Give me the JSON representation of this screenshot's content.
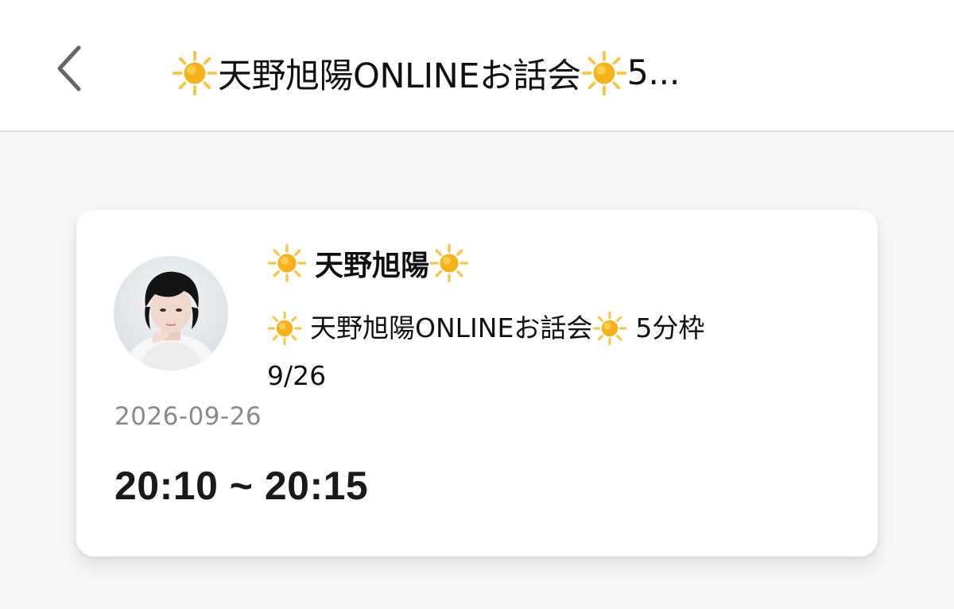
{
  "header": {
    "title": "天野旭陽ONLINEお話会",
    "title_truncated_tail": "5..."
  },
  "card": {
    "host_name": "天野旭陽",
    "event_title_part1": "天野旭陽ONLINEお話会",
    "event_title_part2": "5分枠",
    "event_title_line2": "9/26",
    "date": "2026-09-26",
    "time_range": "20:10 ~ 20:15"
  },
  "icons": {
    "back": "chevron-left-icon",
    "sun": "sun-emoji-icon"
  },
  "colors": {
    "sun_core": "#f6b21a",
    "sun_ray": "#f8c542",
    "date_text": "#8a8a8a",
    "nav_background": "#ffffff",
    "page_background": "#f7f7f7"
  }
}
